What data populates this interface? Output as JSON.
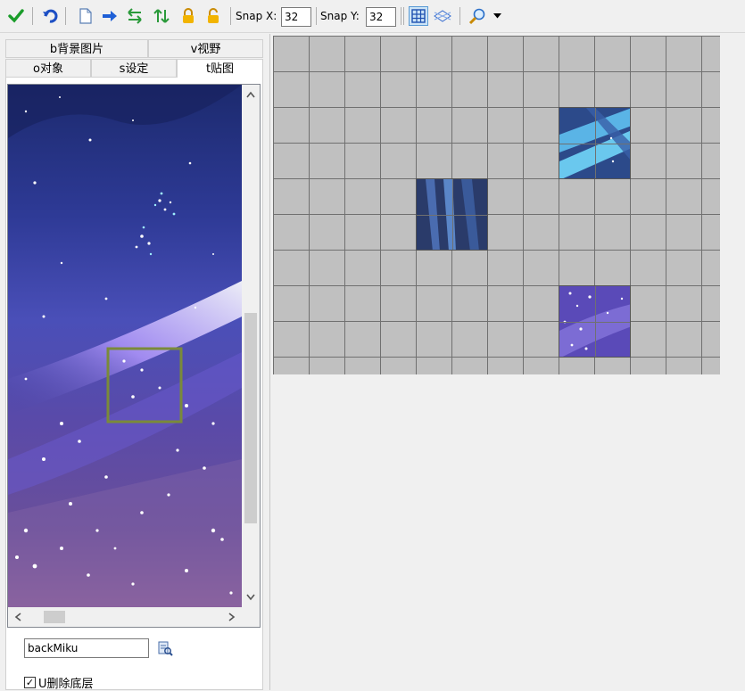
{
  "toolbar": {
    "icons": [
      "check-icon",
      "undo-icon",
      "new-page-icon",
      "arrow-right-icon",
      "swap-horizontal-icon",
      "swap-vertical-icon",
      "lock-icon",
      "unlock-icon",
      "grid-icon",
      "dots-icon",
      "zoom-icon",
      "dropdown-icon"
    ],
    "snap_x_label": "Snap X:",
    "snap_x_value": "32",
    "snap_y_label": "Snap Y:",
    "snap_y_value": "32"
  },
  "tabs": {
    "top_row": [
      "b背景图片",
      "v视野"
    ],
    "bottom_row": [
      "o对象",
      "s设定",
      "t贴图"
    ],
    "active": "t贴图"
  },
  "tileset": {
    "name_value": "backMiku",
    "search_icon": "browse-icon",
    "checkbox_label": "U删除底层",
    "checkbox_checked": true
  },
  "colors": {
    "toolbar_bg": "#f0f0f0",
    "map_cell": "#c0c0c0",
    "grid_line": "#707070",
    "selection_box": "#7a8a3a"
  }
}
